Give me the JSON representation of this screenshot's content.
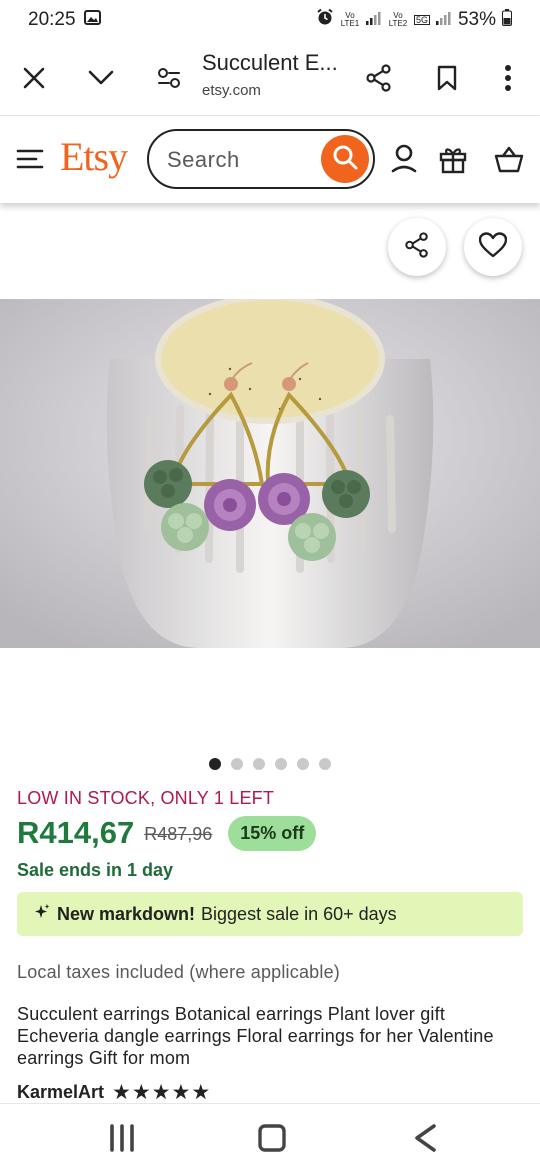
{
  "status_bar": {
    "time": "20:25",
    "battery": "53%",
    "sim1_label": "Vo LTE1",
    "sim2_label": "Vo LTE2",
    "network": "5G"
  },
  "browser": {
    "title": "Succulent E...",
    "url": "etsy.com",
    "icons": [
      "close-icon",
      "chevron-down-icon",
      "site-settings-icon",
      "share-icon",
      "bookmark-icon",
      "more-vert-icon"
    ]
  },
  "header": {
    "logo": "Etsy",
    "search_placeholder": "Search",
    "brand_color": "#f1641e",
    "icons": [
      "menu-icon",
      "search-icon",
      "account-icon",
      "gift-icon",
      "cart-icon"
    ]
  },
  "gallery": {
    "image_count": 6,
    "active_index": 0,
    "actions": [
      "share-icon",
      "heart-icon"
    ]
  },
  "product": {
    "stock_status": "LOW IN STOCK, ONLY 1 LEFT",
    "price": "R414,67",
    "original_price": "R487,96",
    "discount": "15% off",
    "sale_ends": "Sale ends in 1 day",
    "markdown_strong": "New markdown!",
    "markdown_rest": "Biggest sale in 60+ days",
    "taxes": "Local taxes included (where applicable)",
    "title": "Succulent earrings Botanical earrings Plant lover gift Echeveria dangle earrings Floral earrings for her Valentine earrings Gift for mom",
    "shop_name": "KarmelArt",
    "rating_stars": "★★★★★",
    "rating": 5,
    "price_color": "#1f7a3d",
    "stock_color": "#b3184a"
  },
  "nav_bar": {
    "icons": [
      "recent-apps-icon",
      "home-icon",
      "back-icon"
    ]
  }
}
